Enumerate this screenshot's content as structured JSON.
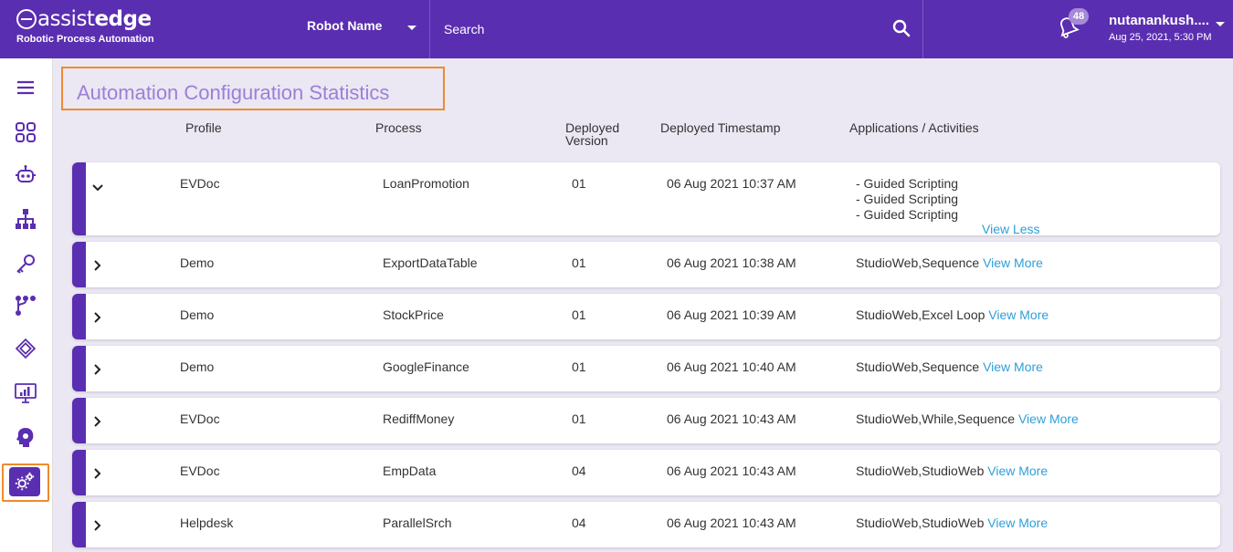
{
  "header": {
    "logo_text_left": "assist",
    "logo_text_right": "edge",
    "logo_subtitle": "Robotic Process Automation",
    "robot_select_label": "Robot Name",
    "search_placeholder": "Search",
    "notification_count": "48",
    "user_name": "nutanankush....",
    "user_datetime": "Aug 25, 2021, 5:30 PM"
  },
  "sidebar": {
    "items": [
      {
        "icon": "menu-icon"
      },
      {
        "icon": "dashboard-grid-icon"
      },
      {
        "icon": "robot-icon"
      },
      {
        "icon": "hierarchy-icon"
      },
      {
        "icon": "key-icon"
      },
      {
        "icon": "workflow-icon"
      },
      {
        "icon": "chip-icon"
      },
      {
        "icon": "monitor-chart-icon"
      },
      {
        "icon": "brain-gear-icon"
      },
      {
        "icon": "settings-gears-icon",
        "active": true
      }
    ]
  },
  "main": {
    "title": "Automation Configuration Statistics",
    "columns": {
      "profile": "Profile",
      "process": "Process",
      "deployed_version_line1": "Deployed",
      "deployed_version_line2": "Version",
      "deployed_timestamp": "Deployed Timestamp",
      "applications": "Applications / Activities"
    },
    "rows": [
      {
        "profile": "EVDoc",
        "process": "LoanPromotion",
        "version": "01",
        "timestamp": "06 Aug 2021 10:37 AM",
        "expanded": true,
        "activities": [
          "- Guided Scripting",
          "- Guided Scripting",
          "- Guided Scripting"
        ],
        "link": "View Less"
      },
      {
        "profile": "Demo",
        "process": "ExportDataTable",
        "version": "01",
        "timestamp": "06 Aug 2021 10:38 AM",
        "apps": "StudioWeb,Sequence",
        "link": "View More"
      },
      {
        "profile": "Demo",
        "process": "StockPrice",
        "version": "01",
        "timestamp": "06 Aug 2021 10:39 AM",
        "apps": "StudioWeb,Excel Loop",
        "link": "View More"
      },
      {
        "profile": "Demo",
        "process": "GoogleFinance",
        "version": "01",
        "timestamp": "06 Aug 2021 10:40 AM",
        "apps": "StudioWeb,Sequence",
        "link": "View More"
      },
      {
        "profile": "EVDoc",
        "process": "RediffMoney",
        "version": "01",
        "timestamp": "06 Aug 2021 10:43 AM",
        "apps": "StudioWeb,While,Sequence",
        "link": "View More"
      },
      {
        "profile": "EVDoc",
        "process": "EmpData",
        "version": "04",
        "timestamp": "06 Aug 2021 10:43 AM",
        "apps": "StudioWeb,StudioWeb",
        "link": "View More"
      },
      {
        "profile": "Helpdesk",
        "process": "ParallelSrch",
        "version": "04",
        "timestamp": "06 Aug 2021 10:43 AM",
        "apps": "StudioWeb,StudioWeb",
        "link": "View More"
      }
    ]
  },
  "colors": {
    "brand": "#5a2eb0",
    "highlight": "#f08a2c",
    "link": "#2f9fd8",
    "background": "#ebe7f3"
  }
}
